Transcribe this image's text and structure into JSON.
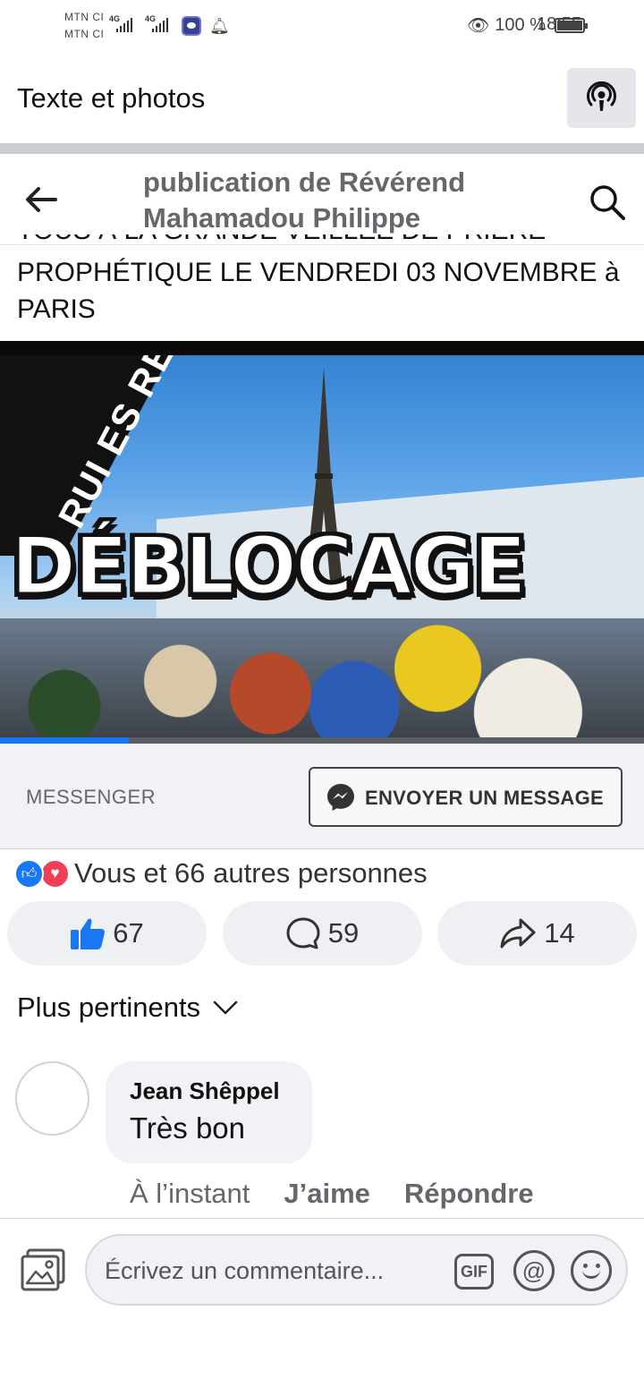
{
  "status_bar": {
    "carrier_1": "MTN CI",
    "carrier_2": "MTN CI",
    "network_1": "4G",
    "network_2": "4G",
    "battery": "100 %",
    "time": "18:55"
  },
  "top_bar": {
    "title": "Texte et photos",
    "cast_icon": "podcast-icon"
  },
  "post_header": {
    "title": "publication de Révérend Mahamadou Philippe",
    "back_icon": "arrow-left-icon",
    "search_icon": "search-icon"
  },
  "post": {
    "text_cut": "TOUS À LA GRANDE VEILLÉE DE PRIÈRE",
    "text": "PROPHÉTIQUE LE VENDREDI 03 NOVEMBRE à PARIS",
    "video": {
      "overlay_word": "DÉBLOCAGE",
      "banner_text": "RUI ES RÉCLA",
      "progress": 0.2
    }
  },
  "messenger": {
    "label": "MESSENGER",
    "button_label": "ENVOYER UN MESSAGE"
  },
  "reactions": {
    "summary": "Vous et 66 autres personnes",
    "like_count": "67",
    "comment_count": "59",
    "share_count": "14"
  },
  "sort": {
    "label": "Plus pertinents"
  },
  "comment": {
    "author": "Jean Shêppel",
    "text": "Très bon",
    "time": "À l’instant",
    "like_label": "J’aime",
    "reply_label": "Répondre"
  },
  "composer": {
    "placeholder": "Écrivez un commentaire...",
    "gif_label": "GIF",
    "at_label": "@"
  },
  "colors": {
    "accent": "#1877f2",
    "love": "#f33e58",
    "muted_text": "#65676b",
    "surface": "#f0f2f5"
  }
}
